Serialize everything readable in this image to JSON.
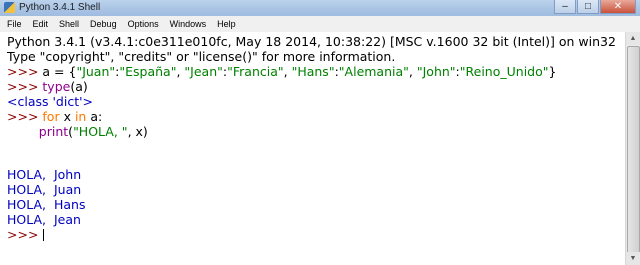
{
  "window": {
    "title": "Python 3.4.1 Shell",
    "buttons": {
      "minimize": "‒",
      "maximize": "□",
      "close": "✕"
    }
  },
  "menu": [
    "File",
    "Edit",
    "Shell",
    "Debug",
    "Options",
    "Windows",
    "Help"
  ],
  "shell": {
    "banner1": "Python 3.4.1 (v3.4.1:c0e311e010fc, May 18 2014, 10:38:22) [MSC v.1600 32 bit (Intel)] on win32",
    "banner2": "Type \"copyright\", \"credits\" or \"license()\" for more information.",
    "prompt": ">>> ",
    "cont_indent": "        ",
    "l3": {
      "a1": "a = {",
      "s1": "\"Juan\"",
      "c1": ":",
      "s2": "\"España\"",
      "c2": ", ",
      "s3": "\"Jean\"",
      "c3": ":",
      "s4": "\"Francia\"",
      "c4": ", ",
      "s5": "\"Hans\"",
      "c5": ":",
      "s6": "\"Alemania\"",
      "c6": ", ",
      "s7": "\"John\"",
      "c7": ":",
      "s8": "\"Reino_Unido\"",
      "c8": "}"
    },
    "l4": {
      "fn": "type",
      "rest": "(a)"
    },
    "l5": "<class 'dict'>",
    "l6": {
      "for": "for",
      "mid": " x ",
      "in": "in",
      "rest": " a:"
    },
    "l7": {
      "fn": "print",
      "p1": "(",
      "s": "\"HOLA, \"",
      "p2": ", x)"
    },
    "output": [
      "HOLA,  John",
      "HOLA,  Juan",
      "HOLA,  Hans",
      "HOLA,  Jean"
    ]
  },
  "colors": {
    "prompt": "#8b0000",
    "string": "#008000",
    "keyword": "#ff7700",
    "builtin": "#900090",
    "output": "#0000c0"
  },
  "icons": [
    "python-app-icon",
    "scroll-up-icon",
    "scroll-down-icon"
  ]
}
